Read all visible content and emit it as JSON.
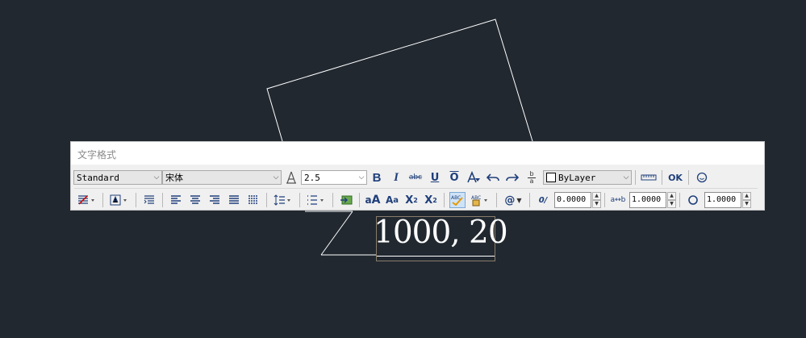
{
  "dialog": {
    "title": "文字格式",
    "style_select": {
      "value": "Standard"
    },
    "font_select": {
      "value": "宋体"
    },
    "height_select": {
      "value": "2.5"
    },
    "color_select": {
      "value": "ByLayer"
    },
    "ok_label": "OK",
    "bold_label": "B",
    "italic_label": "I",
    "strike_label": "abc",
    "underline_label": "U",
    "overline_label": "O",
    "stack_label_top": "b",
    "stack_label_bottom": "a",
    "superscript_label": "X",
    "subscript_label": "X",
    "at_label": "@",
    "oblique_label": "0/",
    "oblique_value": "0.0000",
    "tracking_label": "a↔b",
    "tracking_value": "1.0000",
    "width_factor_value": "1.0000"
  },
  "canvas": {
    "mtext": "1000, 20"
  },
  "colors": {
    "canvas_bg": "#212830",
    "accent_blue": "#1f3f7a",
    "line": "#ffffff"
  }
}
